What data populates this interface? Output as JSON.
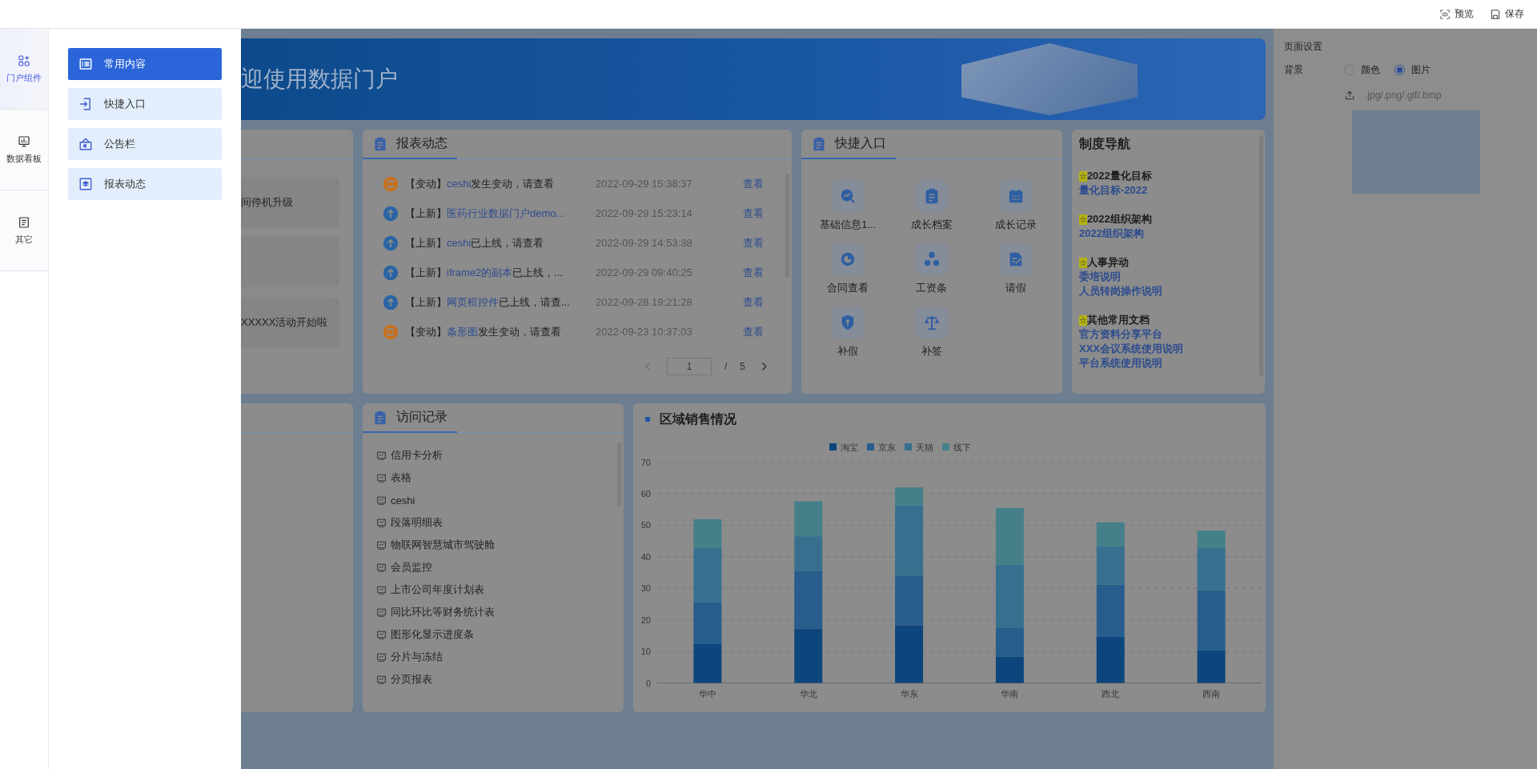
{
  "top_bar": {
    "actions": [
      {
        "kind": "preview",
        "label": "预览"
      },
      {
        "kind": "save",
        "label": "保存"
      }
    ]
  },
  "sidebar": {
    "items": [
      {
        "kind": "components",
        "label": "门户组件",
        "selected": true
      },
      {
        "kind": "dashboard",
        "label": "数据看板",
        "selected": false
      },
      {
        "kind": "other",
        "label": "其它",
        "selected": false
      }
    ]
  },
  "component_panel": {
    "items": [
      {
        "kind": "list",
        "label": "常用内容",
        "selected": true
      },
      {
        "kind": "entry",
        "label": "快捷入口",
        "selected": false
      },
      {
        "kind": "notice",
        "label": "公告栏",
        "selected": false
      },
      {
        "kind": "layers",
        "label": "报表动态",
        "selected": false
      }
    ]
  },
  "canvas": {
    "banner": {
      "title": "迎使用数据门户"
    },
    "notice_card": {
      "tiles": [
        {
          "kind": "text",
          "text": "间停机升级"
        },
        {
          "kind": "blank"
        },
        {
          "kind": "text",
          "text": "XXXXX活动开始啦"
        }
      ]
    },
    "report_card": {
      "title": "报表动态",
      "rows": [
        {
          "kind": "change",
          "tag": "【变动】",
          "link": "ceshi",
          "text": "发生变动，请查看",
          "time": "2022-09-29 15:38:37",
          "action": "查看"
        },
        {
          "kind": "new",
          "tag": "【上新】",
          "link": "医药行业数据门户demo...",
          "time": "2022-09-29 15:23:14",
          "action": "查看"
        },
        {
          "kind": "new",
          "tag": "【上新】",
          "link": "ceshi",
          "text": "已上线，请查看",
          "time": "2022-09-29 14:53:38",
          "action": "查看"
        },
        {
          "kind": "new",
          "tag": "【上新】",
          "link": "iframe2的副本",
          "text": "已上线，...",
          "time": "2022-09-29 09:40:25",
          "action": "查看"
        },
        {
          "kind": "new",
          "tag": "【上新】",
          "link": "网页框控件",
          "text": "已上线，请查...",
          "time": "2022-09-28 19:21:28",
          "action": "查看"
        },
        {
          "kind": "change",
          "tag": "【变动】",
          "link": "条形图",
          "text": "发生变动，请查看",
          "time": "2022-09-23 10:37:03",
          "action": "查看"
        }
      ],
      "pagination": {
        "page": "1",
        "separator": "/",
        "total": "5"
      }
    },
    "quick_card": {
      "title": "快捷入口",
      "items": [
        {
          "kind": "trend",
          "label": "基础信息1..."
        },
        {
          "kind": "clipboard",
          "label": "成长档案"
        },
        {
          "kind": "calendar",
          "label": "成长记录"
        },
        {
          "kind": "pie",
          "label": "合同查看"
        },
        {
          "kind": "nodes",
          "label": "工资条"
        },
        {
          "kind": "edit",
          "label": "请假"
        },
        {
          "kind": "shield",
          "label": "补假"
        },
        {
          "kind": "scale",
          "label": "补签"
        }
      ]
    },
    "nav_card": {
      "title": "制度导航",
      "groups": [
        {
          "star": "☆",
          "title": "2022量化目标",
          "links": [
            "量化目标-2022"
          ]
        },
        {
          "star": "☆",
          "title": "2022组织架构",
          "links": [
            "2022组织架构"
          ]
        },
        {
          "star": "☆",
          "title": "人事异动",
          "links": [
            "委培说明",
            "人员转岗操作说明"
          ]
        },
        {
          "star": "☆",
          "title": "其他常用文档",
          "links": [
            "官方资料分享平台",
            "XXX会议系统使用说明",
            "平台系统使用说明"
          ]
        }
      ]
    },
    "visits_card": {
      "title": "访问记录",
      "items": [
        "信用卡分析",
        "表格",
        "ceshi",
        "段落明细表",
        "物联网智慧城市驾驶舱",
        "会员监控",
        "上市公司年度计划表",
        "同比环比等财务统计表",
        "图形化显示进度条",
        "分片与冻结",
        "分页报表"
      ]
    },
    "sales_card": {
      "title": "区域销售情况",
      "chart_data": {
        "type": "bar",
        "stacked": true,
        "grid": true,
        "legend": true,
        "categories": [
          "华中",
          "华北",
          "华东",
          "华南",
          "西北",
          "西南"
        ],
        "ylim": [
          0,
          70
        ],
        "yticks": [
          0,
          10,
          20,
          30,
          40,
          50,
          60,
          70
        ],
        "series": [
          {
            "name": "淘宝",
            "color": "#0c467c",
            "values": [
              12.3,
              17.2,
              18.3,
              8.4,
              14.6,
              10.3
            ]
          },
          {
            "name": "京东",
            "color": "#275d8c",
            "values": [
              13.3,
              18.2,
              15.6,
              9.0,
              16.6,
              19.1
            ]
          },
          {
            "name": "天猫",
            "color": "#36708e",
            "values": [
              17.1,
              11.1,
              22.4,
              20.0,
              12.2,
              13.5
            ]
          },
          {
            "name": "线下",
            "color": "#45808a",
            "values": [
              9.2,
              11.1,
              5.7,
              18.1,
              7.5,
              5.4
            ]
          }
        ]
      }
    }
  },
  "settings": {
    "title": "页面设置",
    "background": {
      "label": "背景",
      "options": [
        {
          "label": "颜色",
          "selected": false
        },
        {
          "label": "图片",
          "selected": true
        }
      ],
      "upload_hint": ".jpg/.png/.gif/.bmp"
    }
  }
}
